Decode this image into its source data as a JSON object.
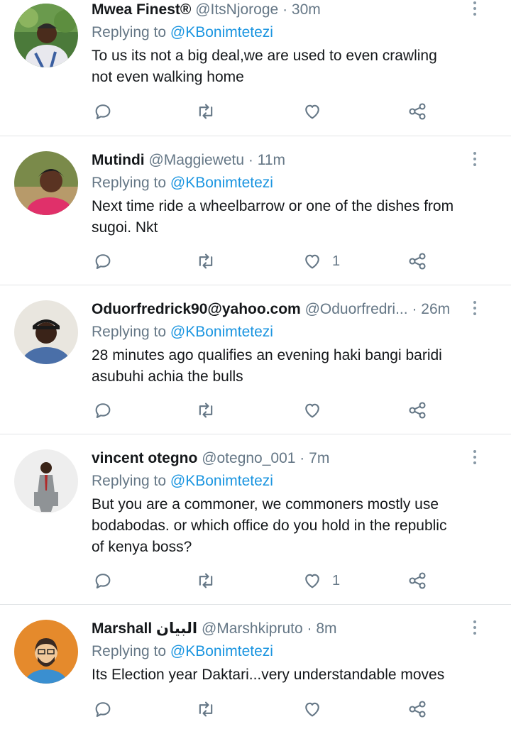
{
  "reply_prefix": "Replying to",
  "tweets": [
    {
      "name": "Mwea Finest®",
      "handle": "@ItsNjoroge",
      "separator": "·",
      "time": "30m",
      "reply_to": "@KBonimtetezi",
      "text_lines": [
        "To us its not a big deal,we are used to even crawling",
        "not even walking home"
      ],
      "like_count": ""
    },
    {
      "name": "Mutindi",
      "handle": "@Maggiewetu",
      "separator": "·",
      "time": "11m",
      "reply_to": "@KBonimtetezi",
      "text_lines": [
        "Next time ride a wheelbarrow or one of the dishes from",
        "sugoi. Nkt"
      ],
      "like_count": "1"
    },
    {
      "name": "Oduorfredrick90@yahoo.com",
      "handle": "@Oduorfredri...",
      "separator": "·",
      "time": "26m",
      "reply_to": "@KBonimtetezi",
      "text_lines": [
        "28 minutes ago qualifies an evening haki bangi baridi",
        "asubuhi achia the bulls"
      ],
      "like_count": ""
    },
    {
      "name": "vincent otegno",
      "handle": "@otegno_001",
      "separator": "·",
      "time": "7m",
      "reply_to": "@KBonimtetezi",
      "text_lines": [
        "But you are a commoner, we commoners mostly use",
        "bodabodas. or which office do you hold in the republic",
        "of kenya boss?"
      ],
      "like_count": "1"
    },
    {
      "name": "Marshall البيان",
      "handle": "@Marshkipruto",
      "separator": "·",
      "time": "8m",
      "reply_to": "@KBonimtetezi",
      "text_lines": [
        "Its Election year Daktari...very understandable moves"
      ],
      "like_count": ""
    }
  ],
  "icons": {
    "reply": "reply-icon",
    "retweet": "retweet-icon",
    "like": "heart-icon",
    "share": "share-icon",
    "more": "more-options-icon"
  },
  "colors": {
    "mention": "#1b95e0",
    "secondary_text": "#657786",
    "divider": "#e1e4e6"
  }
}
